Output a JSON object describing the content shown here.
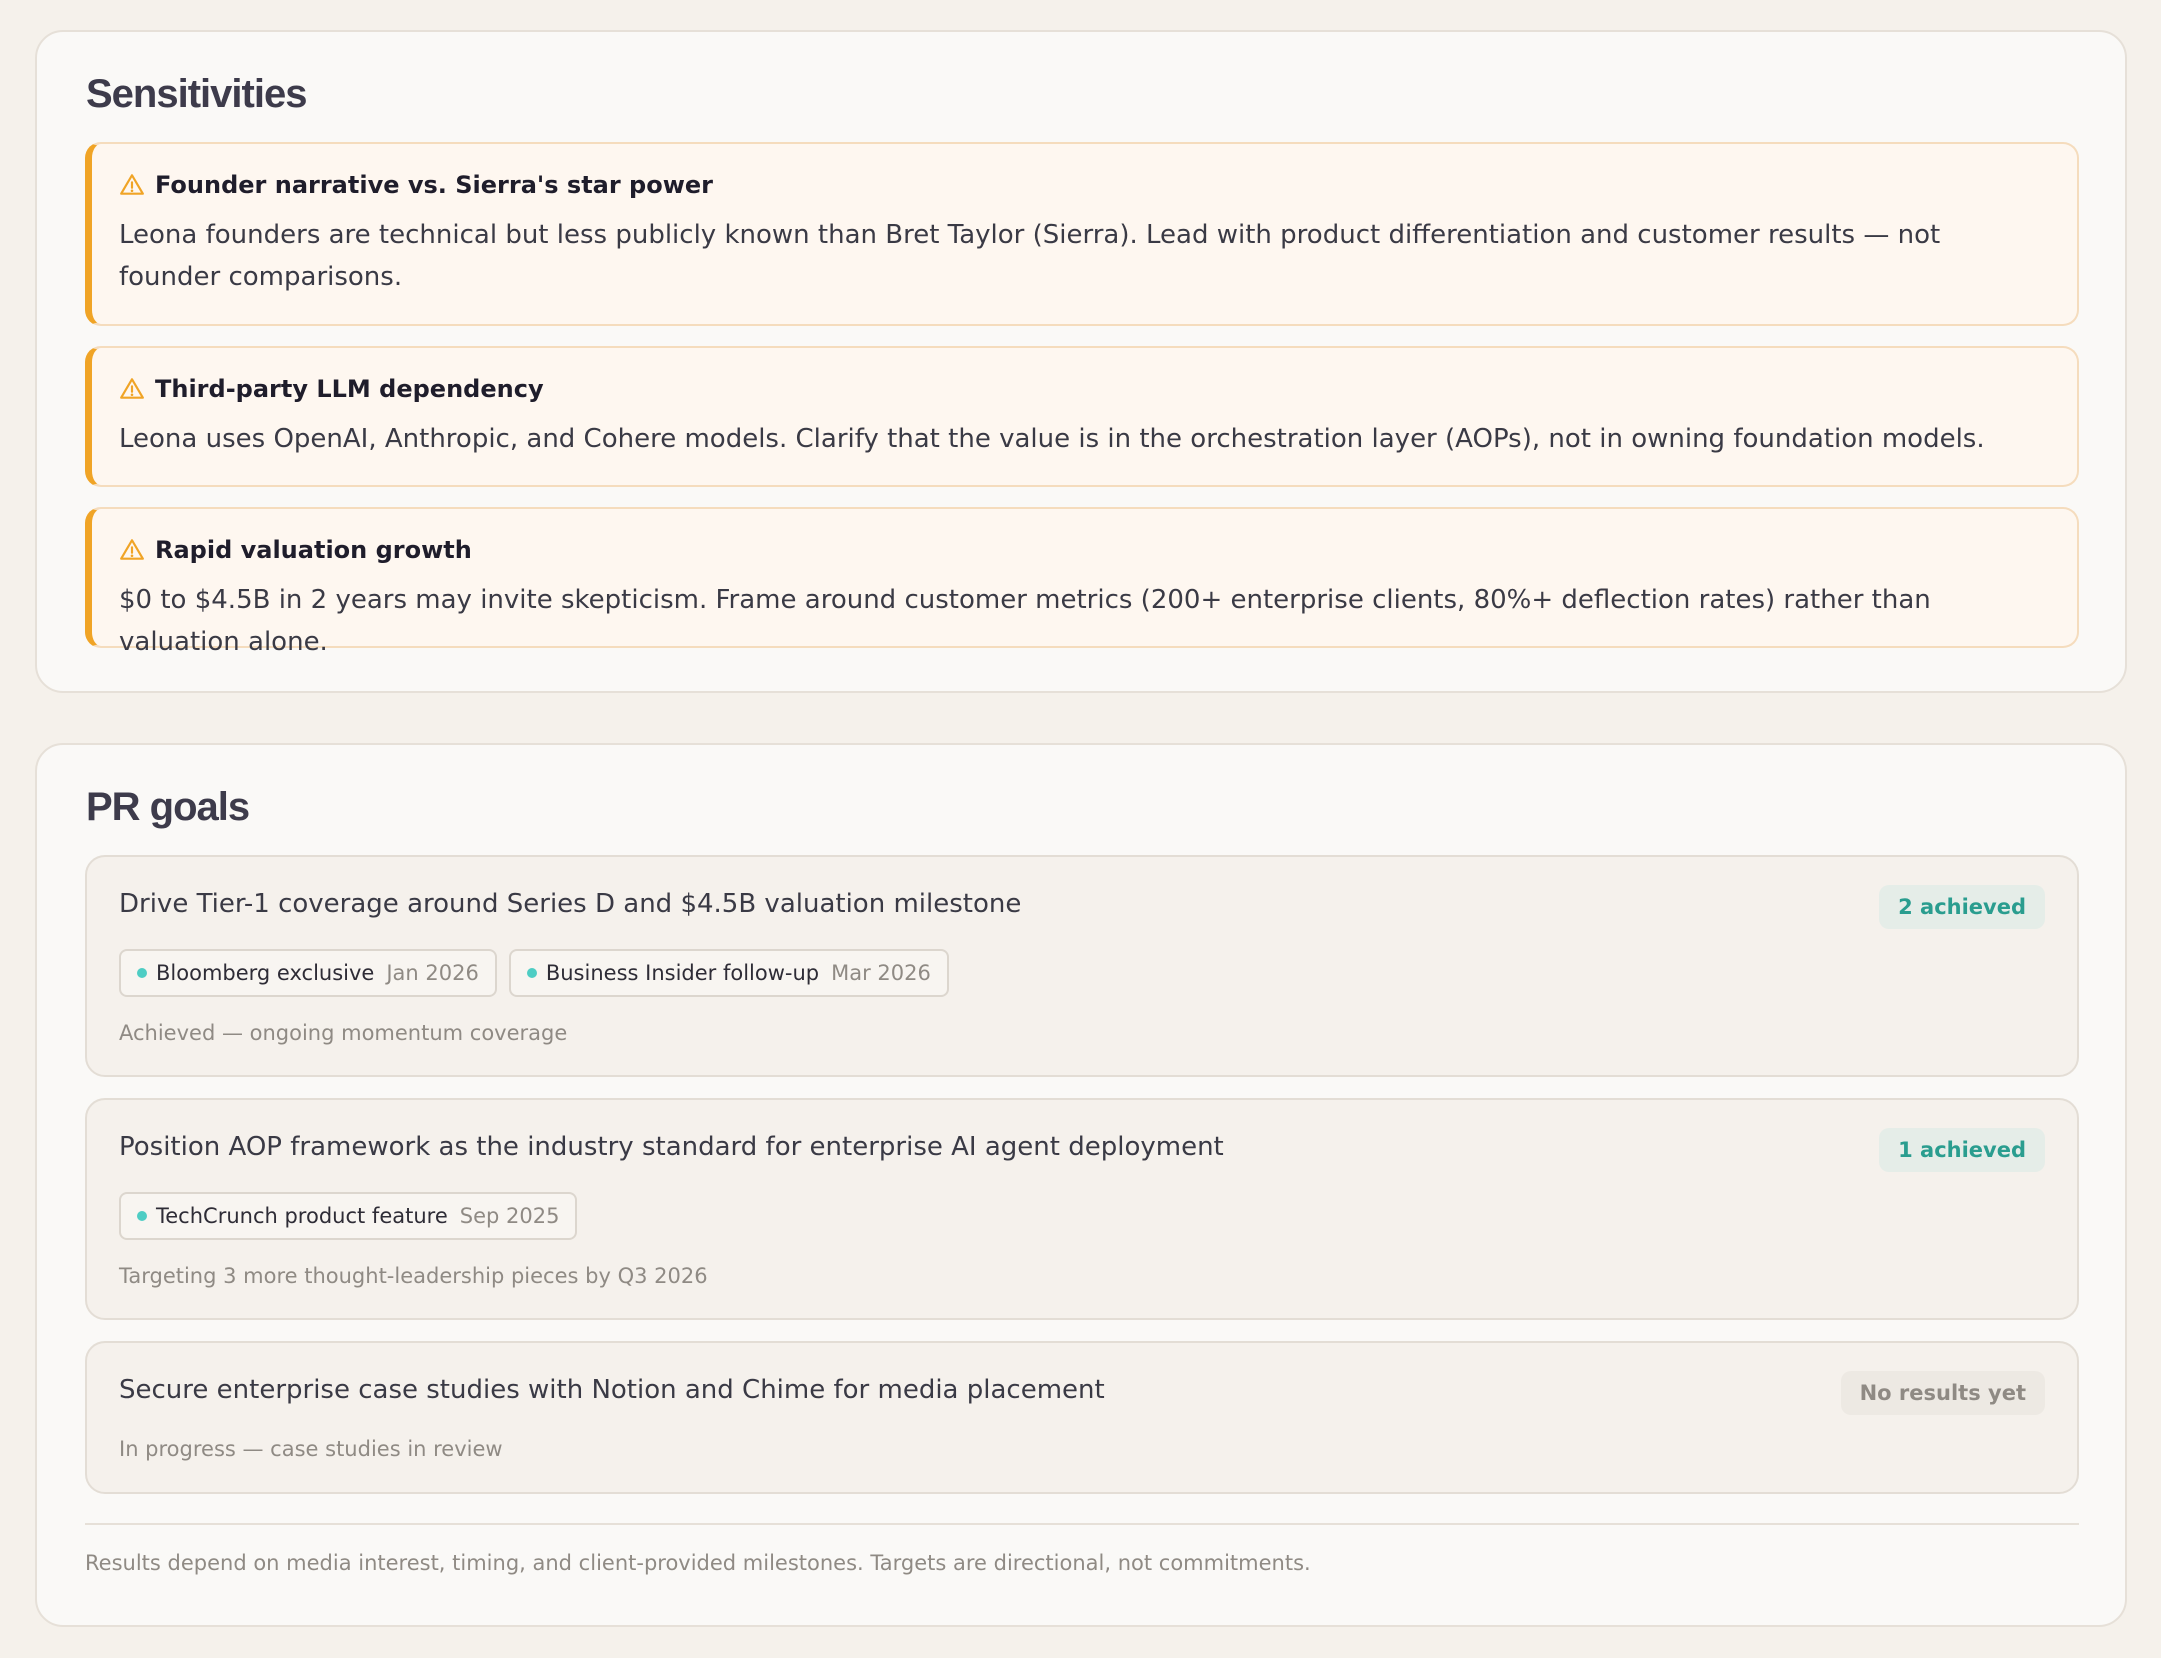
{
  "sensitivities": {
    "title": "Sensitivities",
    "items": [
      {
        "title": "Founder narrative vs. Sierra's star power",
        "body": "Leona founders are technical but less publicly known than Bret Taylor (Sierra). Lead with product differentiation and customer results — not founder comparisons."
      },
      {
        "title": "Third-party LLM dependency",
        "body": "Leona uses OpenAI, Anthropic, and Cohere models. Clarify that the value is in the orchestration layer (AOPs), not in owning foundation models."
      },
      {
        "title": "Rapid valuation growth",
        "body": "$0 to $4.5B in 2 years may invite skepticism. Frame around customer metrics (200+ enterprise clients, 80%+ deflection rates) rather than valuation alone."
      }
    ]
  },
  "pr_goals": {
    "title": "PR goals",
    "goals": [
      {
        "title": "Drive Tier-1 coverage around Series D and $4.5B valuation milestone",
        "badge": "2 achieved",
        "results": [
          {
            "name": "Bloomberg exclusive",
            "date": "Jan 2026"
          },
          {
            "name": "Business Insider follow-up",
            "date": "Mar 2026"
          }
        ],
        "note": "Achieved — ongoing momentum coverage"
      },
      {
        "title": "Position AOP framework as the industry standard for enterprise AI agent deployment",
        "badge": "1 achieved",
        "results": [
          {
            "name": "TechCrunch product feature",
            "date": "Sep 2025"
          }
        ],
        "note": "Targeting 3 more thought-leadership pieces by Q3 2026"
      },
      {
        "title": "Secure enterprise case studies with Notion and Chime for media placement",
        "badge": "No results yet",
        "results": [],
        "note": "In progress — case studies in review"
      }
    ],
    "footer": "Results depend on media interest, timing, and client-provided milestones. Targets are directional, not commitments."
  },
  "colors": {
    "accent_warning": "#f0a426",
    "accent_success": "#2a9d8f",
    "dot": "#4ecdc4"
  },
  "icons": {
    "alert": "warning-triangle-icon",
    "result": "teal-dot"
  }
}
